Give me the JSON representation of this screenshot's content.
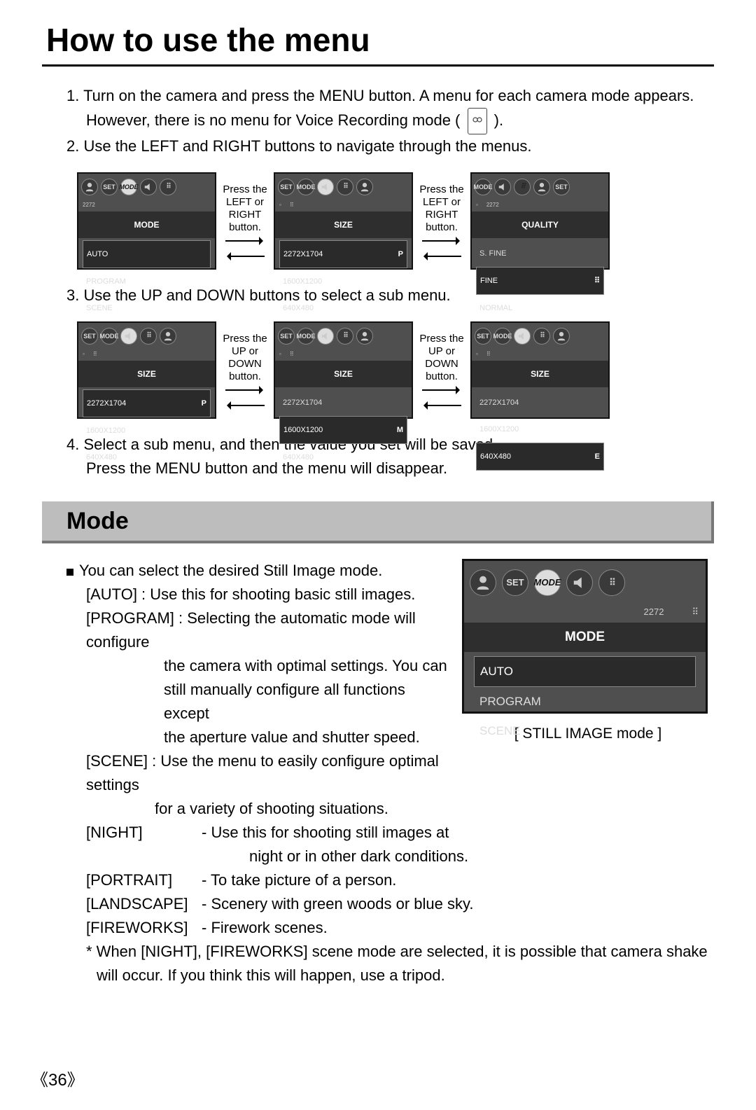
{
  "title": "How to use the menu",
  "steps": {
    "s1a": "1. Turn on the camera and press the MENU button. A menu for each camera mode appears.",
    "s1b": "However, there is no menu for Voice Recording mode (",
    "s1c": ").",
    "s2": "2. Use the LEFT and RIGHT buttons to navigate through the menus.",
    "s3": "3. Use the UP and DOWN buttons to select a sub menu.",
    "s4a": "4. Select a sub menu, and then the value you set will be saved.",
    "s4b": "Press the MENU button and the menu will disappear."
  },
  "nav": {
    "lr": "Press the LEFT or RIGHT button.",
    "ud": "Press the UP or DOWN button."
  },
  "screens": {
    "row1": {
      "s1": {
        "title": "MODE",
        "sub": "2272",
        "items": [
          {
            "label": "AUTO",
            "sel": true
          },
          {
            "label": "PROGRAM"
          },
          {
            "label": "SCENE"
          }
        ]
      },
      "s2": {
        "title": "SIZE",
        "items": [
          {
            "label": "2272X1704",
            "ind": "P",
            "sel": true
          },
          {
            "label": "1600X1200"
          },
          {
            "label": "640X480"
          }
        ]
      },
      "s3": {
        "title": "QUALITY",
        "sub": "2272",
        "items": [
          {
            "label": "S. FINE"
          },
          {
            "label": "FINE",
            "sel": true,
            "dots": true
          },
          {
            "label": "NORMAL"
          }
        ]
      }
    },
    "row2": {
      "s1": {
        "title": "SIZE",
        "items": [
          {
            "label": "2272X1704",
            "ind": "P",
            "sel": true
          },
          {
            "label": "1600X1200"
          },
          {
            "label": "640X480"
          }
        ]
      },
      "s2": {
        "title": "SIZE",
        "items": [
          {
            "label": "2272X1704"
          },
          {
            "label": "1600X1200",
            "ind": "M",
            "sel": true
          },
          {
            "label": "640X480"
          }
        ]
      },
      "s3": {
        "title": "SIZE",
        "items": [
          {
            "label": "2272X1704"
          },
          {
            "label": "1600X1200"
          },
          {
            "label": "640X480",
            "ind": "E",
            "sel": true
          }
        ]
      }
    }
  },
  "section": {
    "title": "Mode",
    "intro": "You can select the desired Still Image mode.",
    "auto": "[AUTO] : Use this for shooting basic still images.",
    "program1": "[PROGRAM] : Selecting the automatic mode will configure",
    "program2": "the camera with optimal settings. You can",
    "program3": "still manually configure all functions except",
    "program4": "the aperture value and shutter speed.",
    "scene1": "[SCENE] : Use the menu to easily configure optimal settings",
    "scene2": "for a variety of shooting situations.",
    "defs": [
      {
        "key": "[NIGHT]",
        "val": "- Use this for shooting still images at",
        "val2": "night or in other dark conditions."
      },
      {
        "key": "[PORTRAIT]",
        "val": "- To take picture of a person."
      },
      {
        "key": "[LANDSCAPE]",
        "val": "- Scenery with green woods or blue sky."
      },
      {
        "key": "[FIREWORKS]",
        "val": "- Firework scenes."
      }
    ],
    "note1": "* When [NIGHT], [FIREWORKS] scene mode are selected, it is possible that camera shake",
    "note2": "will occur. If you think this will happen, use a tripod.",
    "caption": "[ STILL IMAGE mode ]",
    "screen": {
      "title": "MODE",
      "sub": "2272",
      "items": [
        {
          "label": "AUTO",
          "sel": true
        },
        {
          "label": "PROGRAM"
        },
        {
          "label": "SCENE"
        }
      ]
    }
  },
  "icons": {
    "set": "SET",
    "mode": "MODE"
  },
  "page_number": "《36》"
}
